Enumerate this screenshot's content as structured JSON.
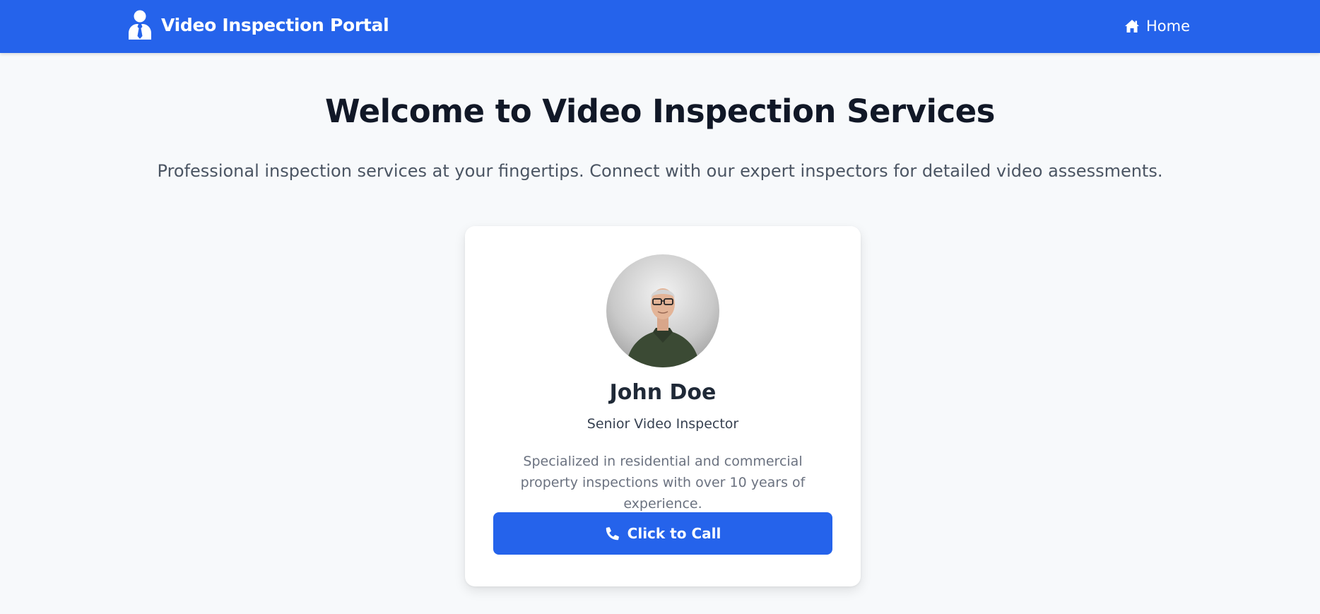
{
  "brand": {
    "title": "Video Inspection Portal",
    "icon": "user-tie-icon"
  },
  "nav": {
    "home_label": "Home",
    "home_icon": "home-icon"
  },
  "hero": {
    "title": "Welcome to Video Inspection Services",
    "subtitle": "Professional inspection services at your fingertips. Connect with our expert inspectors for detailed video assessments."
  },
  "inspector": {
    "name": "John Doe",
    "role": "Senior Video Inspector",
    "bio": "Specialized in residential and commercial property inspections with over 10 years of experience.",
    "call_label": "Click to Call",
    "call_icon": "phone-icon"
  },
  "colors": {
    "primary": "#2563eb",
    "page_background": "#f7f9fb",
    "card_background": "#ffffff",
    "heading": "#111827",
    "muted_text": "#6b7280"
  }
}
